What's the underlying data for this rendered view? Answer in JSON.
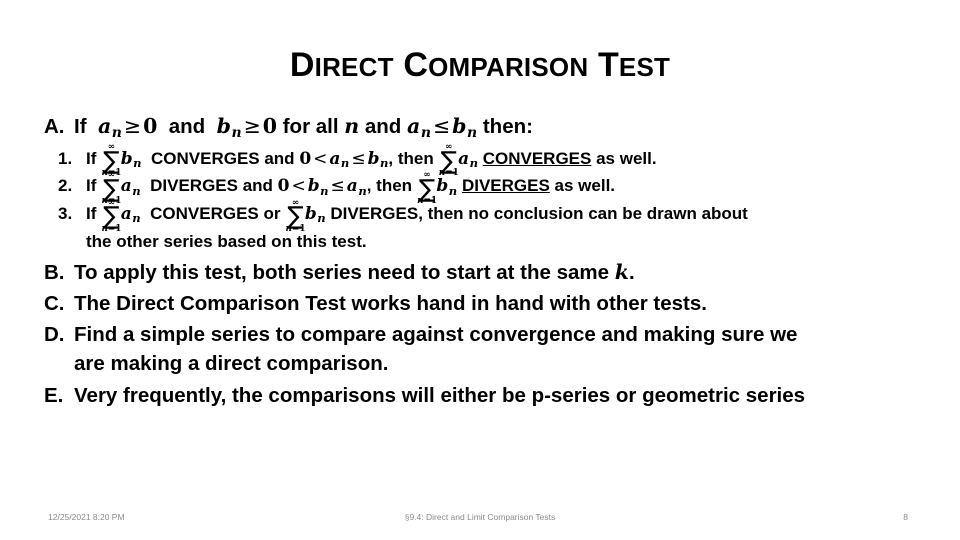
{
  "slide": {
    "title_word_1_first": "D",
    "title_word_1_rest": "IRECT",
    "title_word_2_first": "C",
    "title_word_2_rest": "OMPARISON",
    "title_word_3_first": "T",
    "title_word_3_rest": "EST",
    "title_plain": "Direct Comparison Test"
  },
  "outline": {
    "a": {
      "marker": "A.",
      "t1": "If",
      "var_a": "a",
      "sub_n": "n",
      "op_ge_1": "≥",
      "zero_1": "0",
      "t2": "and",
      "var_b": "b",
      "op_ge_2": "≥",
      "zero_2": "0",
      "t3": "for all",
      "var_n": "n",
      "t4": "and",
      "var_a2": "a",
      "op_le": "≤",
      "var_b2": "b",
      "t5": "then:"
    },
    "a1": {
      "marker": "1.",
      "t1": "If",
      "sigma": "∑",
      "lim_top": "∞",
      "lim_bot_var": "n",
      "lim_bot_eq": "=1",
      "series": "b",
      "sub_n": "n",
      "t2": "CONVERGES and",
      "zero": "0",
      "op_lt": "<",
      "var_a": "a",
      "op_le": "≤",
      "var_b": "b",
      "t3": ", then",
      "series2": "a",
      "result": "CONVERGES",
      "t4": "as well."
    },
    "a2": {
      "marker": "2.",
      "t1": "If",
      "sigma": "∑",
      "lim_top": "∞",
      "lim_bot_var": "n",
      "lim_bot_eq": "=1",
      "series": "a",
      "sub_n": "n",
      "t2": "DIVERGES and",
      "zero": "0",
      "op_lt": "<",
      "var_b": "b",
      "op_le": "≤",
      "var_a": "a",
      "t3": ", then",
      "series2": "b",
      "result": "DIVERGES",
      "t4": "as well."
    },
    "a3": {
      "marker": "3.",
      "t1": "If",
      "sigma": "∑",
      "lim_top": "∞",
      "lim_bot_var": "n",
      "lim_bot_eq": "=1",
      "series": "a",
      "sub_n": "n",
      "t2": "CONVERGES or",
      "series2": "b",
      "t3": "DIVERGES, then no conclusion can be drawn about",
      "line2": "the other series based on this test."
    },
    "b": {
      "marker": "B.",
      "text": "To apply this test, both series need to start at the same",
      "var_k": "k",
      "period": "."
    },
    "c": {
      "marker": "C.",
      "text": "The Direct Comparison Test works hand in hand with other tests."
    },
    "d": {
      "marker": "D.",
      "line1": "Find a simple series to compare against convergence and making sure we",
      "line2": "are making a direct comparison."
    },
    "e": {
      "marker": "E.",
      "text": "Very frequently, the comparisons will either be p-series or geometric series"
    }
  },
  "footer": {
    "timestamp": "12/25/2021 8:20 PM",
    "section": "§9.4: Direct and Limit Comparison Tests",
    "page_number": "8"
  }
}
